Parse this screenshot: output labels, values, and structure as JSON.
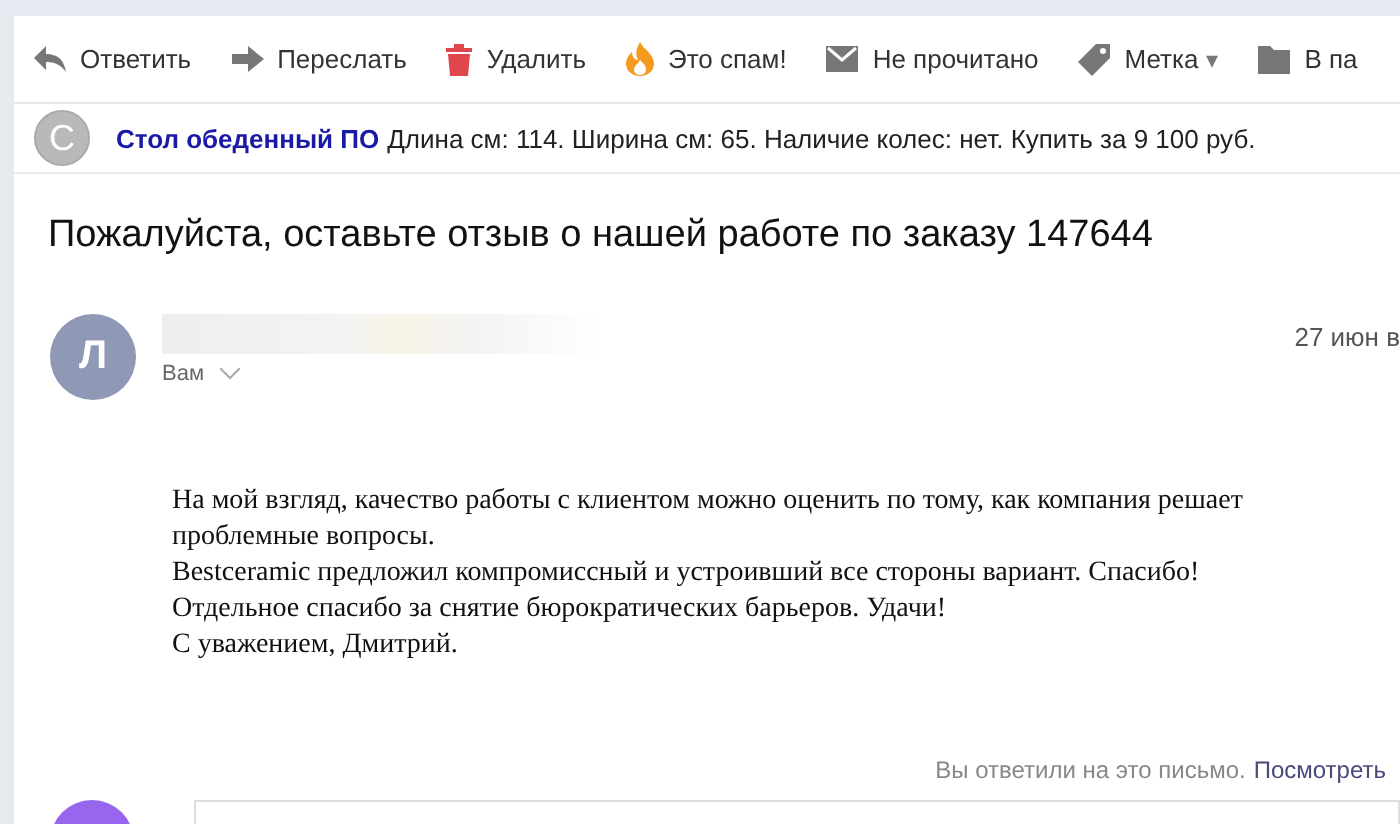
{
  "toolbar": [
    {
      "kind": "reply",
      "label": "Ответить"
    },
    {
      "kind": "forward",
      "label": "Переслать"
    },
    {
      "kind": "delete",
      "label": "Удалить"
    },
    {
      "kind": "spam",
      "label": "Это спам!"
    },
    {
      "kind": "unread",
      "label": "Не прочитано"
    },
    {
      "kind": "label",
      "label": "Метка",
      "caret": "▾"
    },
    {
      "kind": "folder",
      "label": "В па"
    }
  ],
  "ad": {
    "avatar": "С",
    "title": "Стол обеденный ПО",
    "text": "Длина см: 114. Ширина см: 65. Наличие колес: нет. Купить за 9 100 руб."
  },
  "subject": "Пожалуйста, оставьте отзыв о нашей работе по заказу 147644",
  "message": {
    "avatar": "Л",
    "recipient": "Вам",
    "date": "27 июн в",
    "body": [
      "На мой взгляд, качество работы с клиентом можно оценить по тому, как компания решает проблемные вопросы.",
      "Bestceramic предложил компромиссный и устроивший все стороны вариант. Спасибо!",
      "Отдельное спасибо за снятие бюрократических барьеров. Удачи!",
      "С уважением, Дмитрий."
    ]
  },
  "reply_note": {
    "text": "Вы ответили на это письмо.",
    "link": "Посмотреть"
  }
}
